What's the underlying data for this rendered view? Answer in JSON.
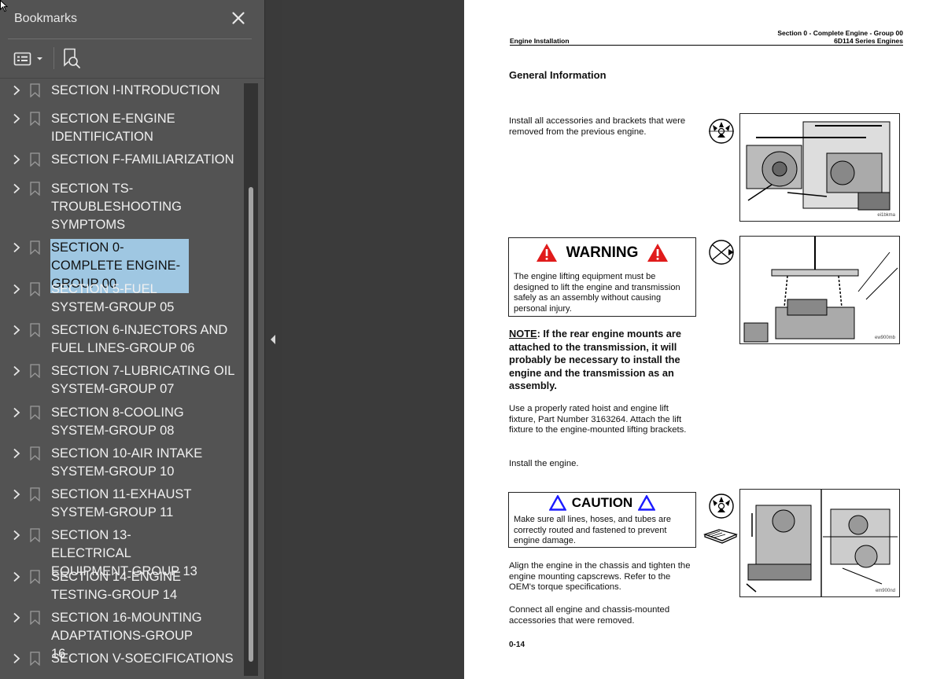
{
  "bookmarks_panel": {
    "title": "Bookmarks",
    "items": [
      {
        "label": "SECTION I-INTRODUCTION",
        "selected": false
      },
      {
        "label": "SECTION E-ENGINE IDENTIFICATION",
        "selected": false
      },
      {
        "label": "SECTION F-FAMILIARIZATION",
        "selected": false
      },
      {
        "label": "SECTION TS-TROUBLESHOOTING SYMPTOMS",
        "selected": false
      },
      {
        "label": "SECTION 0-COMPLETE ENGINE-GROUP 00",
        "selected": true
      },
      {
        "label": "SECTION 5-FUEL SYSTEM-GROUP 05",
        "selected": false
      },
      {
        "label": "SECTION 6-INJECTORS AND FUEL LINES-GROUP 06",
        "selected": false
      },
      {
        "label": "SECTION 7-LUBRICATING OIL SYSTEM-GROUP 07",
        "selected": false
      },
      {
        "label": "SECTION 8-COOLING SYSTEM-GROUP 08",
        "selected": false
      },
      {
        "label": "SECTION 10-AIR INTAKE SYSTEM-GROUP 10",
        "selected": false
      },
      {
        "label": "SECTION 11-EXHAUST SYSTEM-GROUP 11",
        "selected": false
      },
      {
        "label": "SECTION 13-ELECTRICAL EQUIPMENT-GROUP 13",
        "selected": false
      },
      {
        "label": "SECTION 14-ENGINE TESTING-GROUP 14",
        "selected": false
      },
      {
        "label": "SECTION 16-MOUNTING ADAPTATIONS-GROUP 16",
        "selected": false
      },
      {
        "label": "SECTION V-SOECIFICATIONS",
        "selected": false
      }
    ]
  },
  "document": {
    "header_left": "Engine Installation",
    "header_right_line1": "Section 0 - Complete Engine - Group 00",
    "header_right_line2": "6D114 Series Engines",
    "heading": "General Information",
    "para1": "Install all accessories and brackets that were removed from the previous engine.",
    "warning_title": "WARNING",
    "warning_text": "The engine lifting equipment must be designed to lift the engine and transmission safely as an assembly without causing personal injury.",
    "note_label": "NOTE",
    "note_text": ": If the rear engine mounts are attached to the transmission, it will probably be necessary to install the engine and the transmission as an assembly.",
    "para2": "Use a properly rated hoist and engine lift fixture, Part Number 3163264. Attach the lift fixture to the engine-mounted lifting brackets.",
    "para3": "Install the engine.",
    "caution_title": "CAUTION",
    "caution_text": "Make sure all lines, hoses, and tubes are correctly routed and fastened to prevent engine damage.",
    "para4": "Align the engine in the chassis and tighten the engine mounting capscrews. Refer to the OEM's torque specifications.",
    "para5": "Connect all engine and chassis-mounted accessories that were removed.",
    "page_number": "0-14",
    "fig1_caption": "ei1bkma",
    "fig2_caption": "ew900mb",
    "fig3_caption": "em900nd"
  },
  "colors": {
    "panel_bg": "#535353",
    "selection_bg": "#9fc7e2",
    "viewer_bg": "#3b3b3b",
    "warning_red": "#e01b1b",
    "caution_blue": "#1a1aff"
  },
  "icons": {
    "close": "close-icon",
    "options": "options-menu-icon",
    "find_bookmark": "find-current-bookmark-icon",
    "expand": "chevron-right-icon",
    "bookmark": "bookmark-icon",
    "collapse": "collapse-panel-icon"
  }
}
